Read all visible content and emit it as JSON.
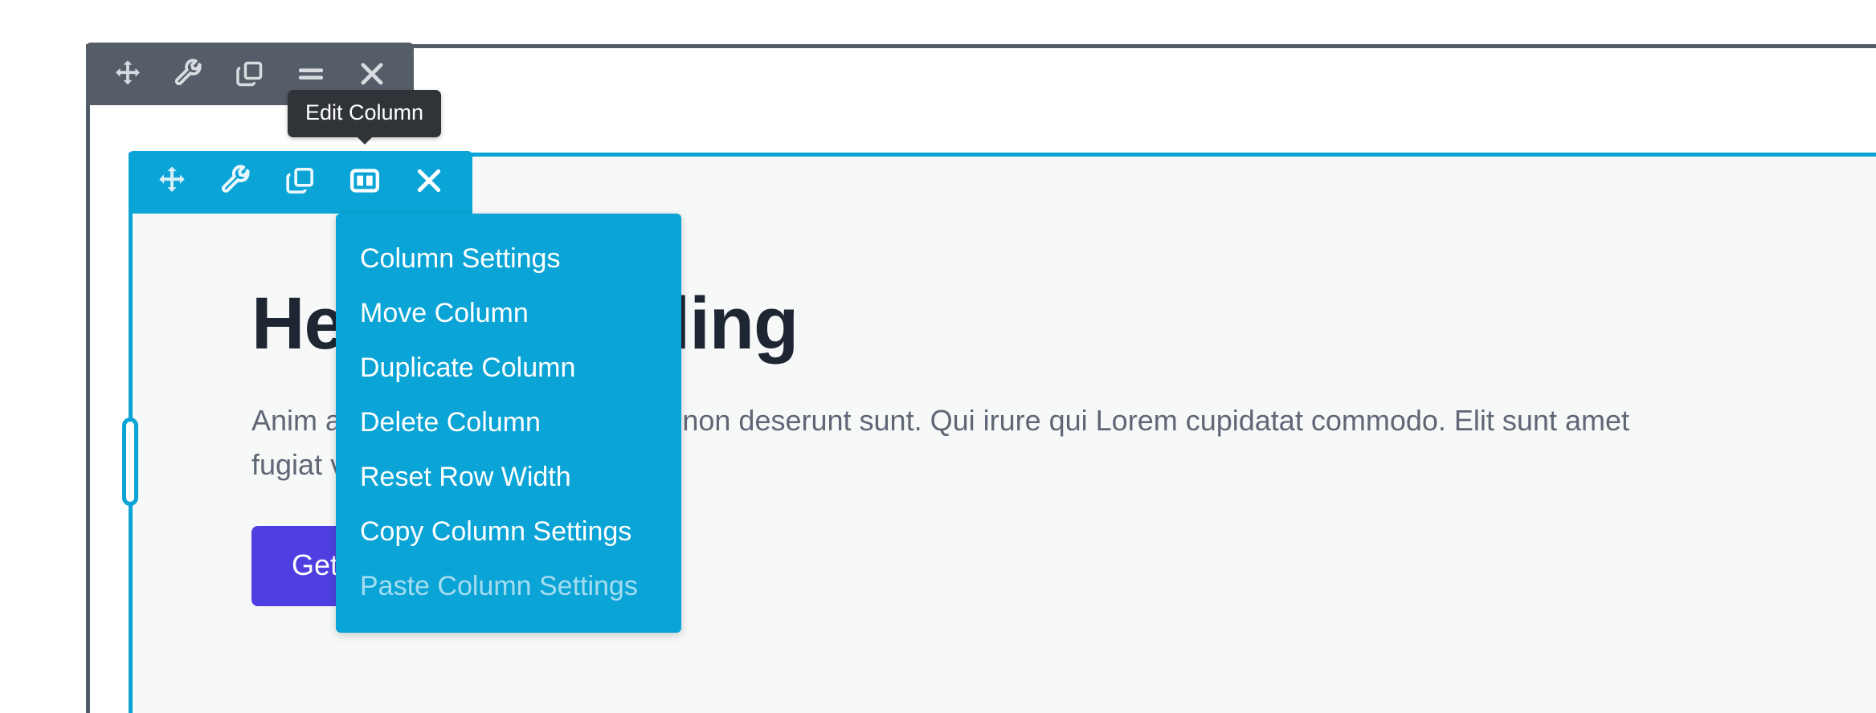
{
  "row_toolbar": {
    "name": "row-toolbar",
    "background": "#555e68",
    "buttons": [
      {
        "icon": "move-icon",
        "label": "Move Row"
      },
      {
        "icon": "wrench-icon",
        "label": "Edit Row"
      },
      {
        "icon": "duplicate-icon",
        "label": "Duplicate Row"
      },
      {
        "icon": "menu-icon",
        "label": "Row Options"
      },
      {
        "icon": "close-icon",
        "label": "Delete Row"
      }
    ]
  },
  "tooltip": {
    "text": "Edit Column",
    "background": "#303337"
  },
  "column_toolbar": {
    "name": "column-toolbar",
    "background": "#0aa4d6",
    "buttons": [
      {
        "icon": "move-icon",
        "label": "Move Column",
        "active": false
      },
      {
        "icon": "wrench-icon",
        "label": "Column Settings",
        "active": false
      },
      {
        "icon": "duplicate-icon",
        "label": "Duplicate Column",
        "active": false
      },
      {
        "icon": "columns-icon",
        "label": "Edit Column",
        "active": true
      },
      {
        "icon": "close-icon",
        "label": "Delete Column",
        "active": false
      }
    ]
  },
  "dropdown": {
    "background": "#0aa4d6",
    "items": [
      {
        "label": "Column Settings",
        "disabled": false
      },
      {
        "label": "Move Column",
        "disabled": false
      },
      {
        "label": "Duplicate Column",
        "disabled": false
      },
      {
        "label": "Delete Column",
        "disabled": false
      },
      {
        "label": "Reset Row Width",
        "disabled": false
      },
      {
        "label": "Copy Column Settings",
        "disabled": false
      },
      {
        "label": "Paste Column Settings",
        "disabled": true
      }
    ]
  },
  "content": {
    "heading": "Heading Styling",
    "paragraph": "Anim aute id magna aliqua ad ad non deserunt sunt. Qui irure qui Lorem cupidatat commodo. Elit sunt amet fugiat veniam occaecat fugiat.",
    "cta_label": "Get Started",
    "cta_color": "#4f3fe0",
    "heading_color": "#1e2533",
    "paragraph_color": "#5f6776",
    "background": "#f7f8f8"
  },
  "borders": {
    "row_border_color": "#525c66",
    "column_border_color": "#0aa4d6"
  },
  "handle": {
    "name": "column-resize-handle"
  }
}
